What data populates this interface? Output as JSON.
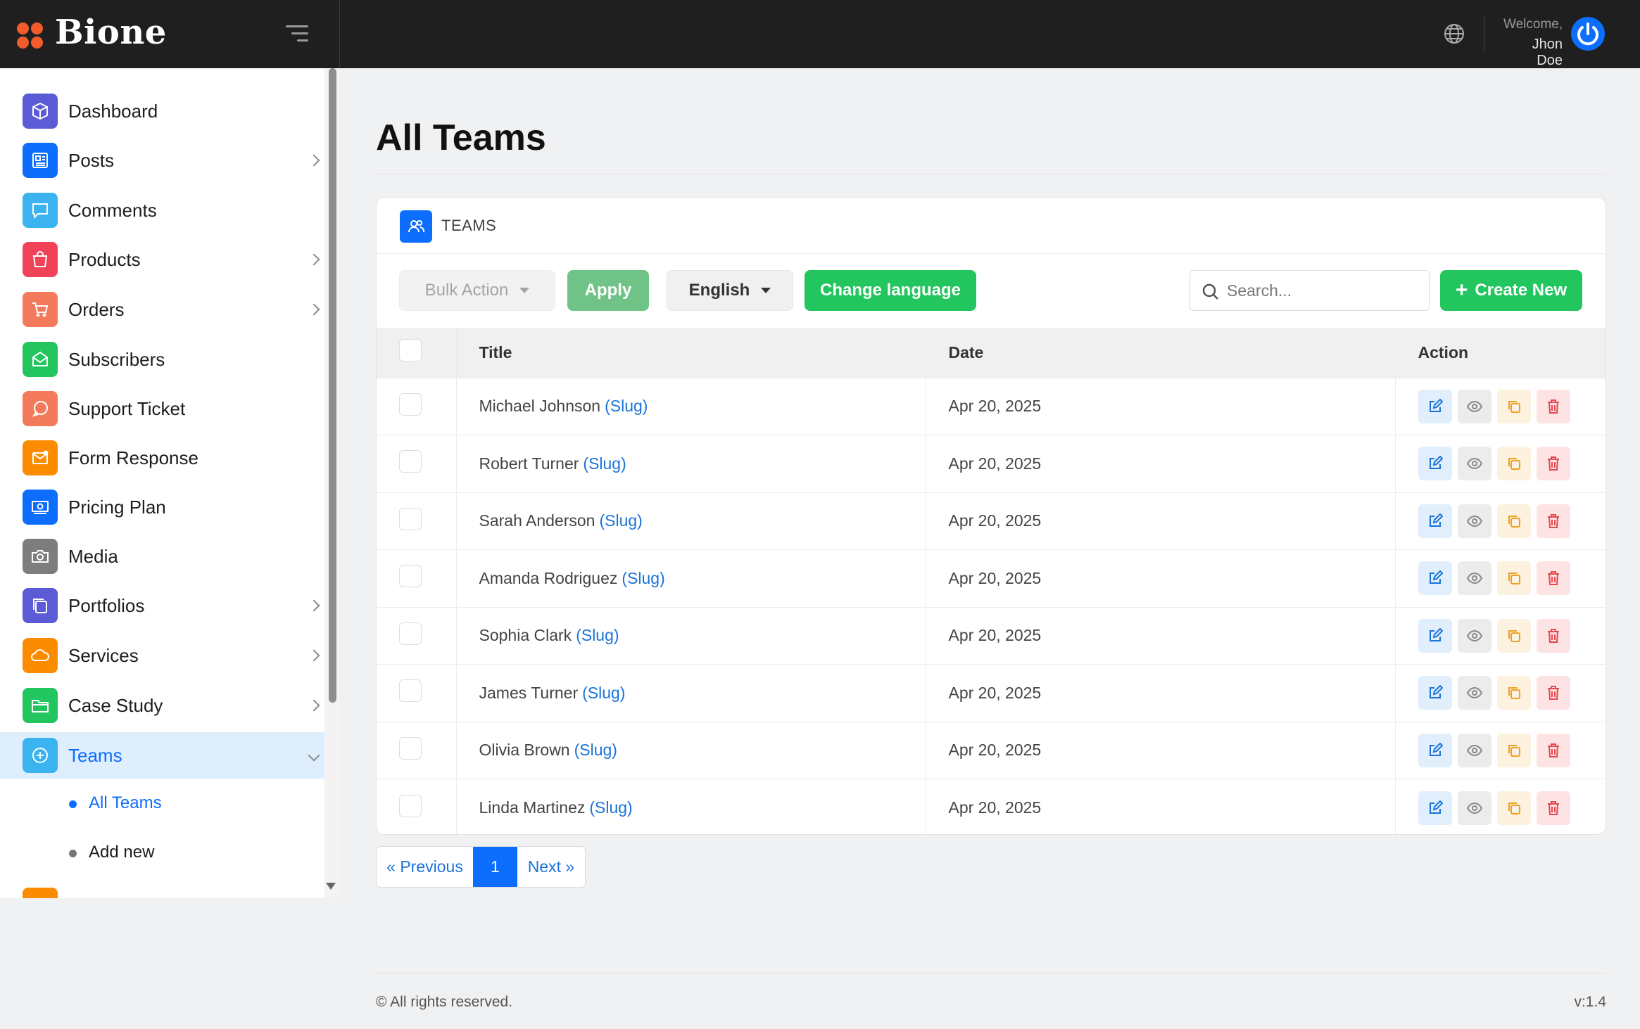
{
  "brand": {
    "name": "Bione",
    "color": "#f25c2a"
  },
  "header": {
    "welcome": "Welcome,",
    "user_name": "Jhon Doe"
  },
  "sidebar": {
    "items": [
      {
        "label": "Dashboard",
        "icon": "cube-icon",
        "color": "#5b5bd6"
      },
      {
        "label": "Posts",
        "icon": "newspaper-icon",
        "color": "#0d6efd"
      },
      {
        "label": "Comments",
        "icon": "chat-bubble-icon",
        "color": "#3bb3f0"
      },
      {
        "label": "Products",
        "icon": "shopping-bag-icon",
        "color": "#f0435a"
      },
      {
        "label": "Orders",
        "icon": "cart-icon",
        "color": "#f37a5a"
      },
      {
        "label": "Subscribers",
        "icon": "envelope-open-icon",
        "color": "#22c55e"
      },
      {
        "label": "Support Ticket",
        "icon": "support-bubble-icon",
        "color": "#f37a5a"
      },
      {
        "label": "Form Response",
        "icon": "mail-icon",
        "color": "#fb8c00"
      },
      {
        "label": "Pricing Plan",
        "icon": "cash-icon",
        "color": "#0d6efd"
      },
      {
        "label": "Media",
        "icon": "camera-icon",
        "color": "#7d7d7d"
      },
      {
        "label": "Portfolios",
        "icon": "layers-icon",
        "color": "#5b5bd6"
      },
      {
        "label": "Services",
        "icon": "cloud-icon",
        "color": "#fb8c00"
      },
      {
        "label": "Case Study",
        "icon": "folder-icon",
        "color": "#22c55e"
      },
      {
        "label": "Teams",
        "icon": "plus-circle-icon",
        "color": "#3bb3f0"
      }
    ],
    "sub_items": [
      {
        "label": "All Teams"
      },
      {
        "label": "Add new"
      }
    ]
  },
  "page": {
    "title": "All Teams"
  },
  "card": {
    "title": "TEAMS"
  },
  "toolbar": {
    "bulk_action": "Bulk Action",
    "apply": "Apply",
    "language": "English",
    "change_language": "Change language",
    "search_placeholder": "Search...",
    "create_new": "Create New"
  },
  "table": {
    "headers": {
      "title": "Title",
      "date": "Date",
      "action": "Action"
    },
    "slug_label": "(Slug)",
    "rows": [
      {
        "title": "Michael Johnson",
        "date": "Apr 20, 2025"
      },
      {
        "title": "Robert Turner",
        "date": "Apr 20, 2025"
      },
      {
        "title": "Sarah Anderson",
        "date": "Apr 20, 2025"
      },
      {
        "title": "Amanda Rodriguez",
        "date": "Apr 20, 2025"
      },
      {
        "title": "Sophia Clark",
        "date": "Apr 20, 2025"
      },
      {
        "title": "James Turner",
        "date": "Apr 20, 2025"
      },
      {
        "title": "Olivia Brown",
        "date": "Apr 20, 2025"
      },
      {
        "title": "Linda Martinez",
        "date": "Apr 20, 2025"
      }
    ]
  },
  "pagination": {
    "previous": "« Previous",
    "current": "1",
    "next": "Next »"
  },
  "footer": {
    "copyright": "© All rights reserved.",
    "version": "v:1.4"
  }
}
